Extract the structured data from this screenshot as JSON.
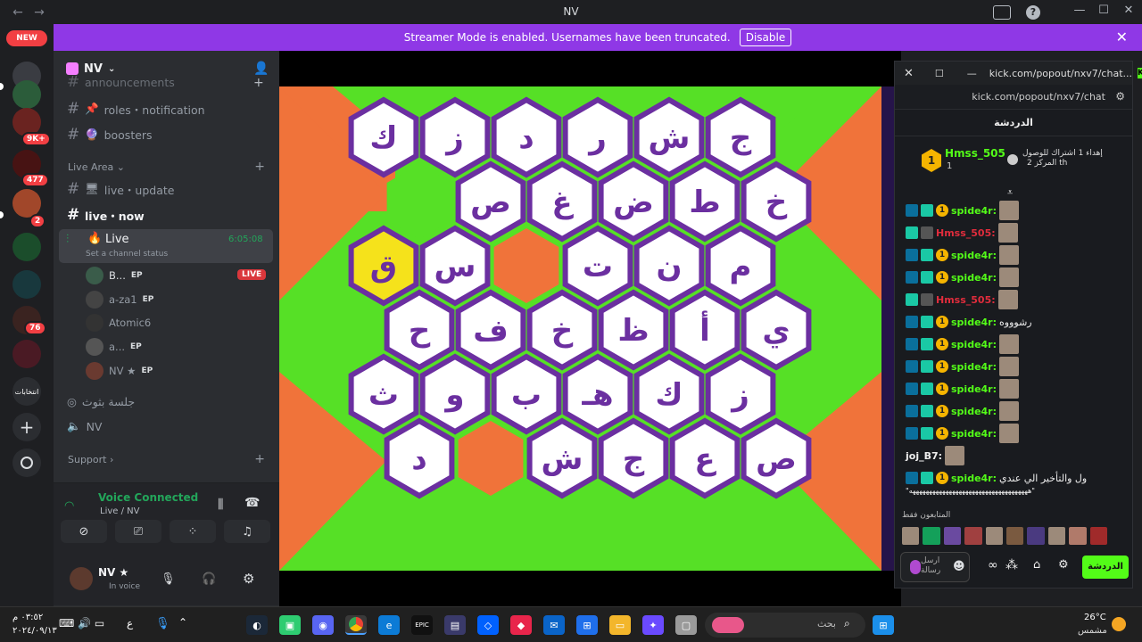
{
  "titlebar": {
    "title": "NV",
    "back": "←",
    "forward": "→",
    "minimize": "—",
    "maximize": "☐",
    "close": "✕"
  },
  "rail": {
    "new_label": "NEW",
    "badges": [
      "9K+",
      "477",
      "2",
      "76"
    ],
    "server_label": "انتخابات",
    "add": "+"
  },
  "banner": {
    "text": "Streamer Mode is enabled. Usernames have been truncated.",
    "button": "Disable",
    "close": "✕"
  },
  "server": {
    "name": "NV"
  },
  "channels": {
    "top_cut": "announcements",
    "roles": "roles・notification",
    "boosters": "boosters",
    "cat_live": "Live Area",
    "live_update": "live・update",
    "live_now": "live・now",
    "voice_live": "Live",
    "voice_live_time": "6:05:08",
    "voice_live_status": "Set a channel status",
    "voice_jalsa": "جلسة بثوث",
    "voice_nv": "NV",
    "cat_support": "Support"
  },
  "voice_users": [
    {
      "name": "B...",
      "ep": "EP",
      "live": "LIVE"
    },
    {
      "name": "a-za1",
      "ep": "EP"
    },
    {
      "name": "Atomic6",
      "ep": ""
    },
    {
      "name": "a...",
      "ep": "EP"
    },
    {
      "name": "NV ★",
      "ep": "EP"
    }
  ],
  "voice_panel": {
    "status": "Voice Connected",
    "channel": "Live / NV"
  },
  "user_panel": {
    "name": "NV ★",
    "status": "In voice"
  },
  "game": {
    "rows": [
      [
        "ك",
        "ز",
        "د",
        "ر",
        "ش",
        "ج"
      ],
      [
        "",
        "ص",
        "غ",
        "ض",
        "ط",
        "خ"
      ],
      [
        "ق",
        "س",
        "",
        "ت",
        "ن",
        "م"
      ],
      [
        "ح",
        "ف",
        "خ",
        "ظ",
        "أ",
        "ي"
      ],
      [
        "ث",
        "و",
        "ب",
        "هـ",
        "ك",
        "ز"
      ],
      [
        "د",
        "",
        "ش",
        "ج",
        "ع",
        "ص"
      ]
    ],
    "green": "#56e026",
    "orange": "#f0733a",
    "purple": "#6b2fa0",
    "yellow": "#f5e21b"
  },
  "kick": {
    "url_title": "kick.com/popout/nxv7/chat...",
    "url": "kick.com/popout/nxv7/chat",
    "chat_title": "الدردشة",
    "gifter_name": "Hmss_505",
    "gifter_count": "1",
    "gifter_rank": "1",
    "gift_line1": "إهداء 1 اشتراك للوصول",
    "gift_line2": "2 المركز th",
    "messages": [
      {
        "user": "spide4r",
        "text": ""
      },
      {
        "user": "Hmss_505",
        "text": ""
      },
      {
        "user": "spide4r",
        "text": ""
      },
      {
        "user": "spide4r",
        "text": ""
      },
      {
        "user": "Hmss_505",
        "text": ""
      },
      {
        "user": "spide4r",
        "text": "رشوووه"
      },
      {
        "user": "spide4r",
        "text": ""
      },
      {
        "user": "spide4r",
        "text": ""
      },
      {
        "user": "spide4r",
        "text": ""
      },
      {
        "user": "spide4r",
        "text": ""
      },
      {
        "user": "spide4r",
        "text": ""
      },
      {
        "user": "joj_B7",
        "text": ""
      },
      {
        "user": "spide4r",
        "text": "ول والتأخير الي عندي"
      }
    ],
    "spam_line": "\"ههههههههههههههههههههههههههههههههههههه\"",
    "viewers_label": "المتابعون فقط",
    "chat_button": "الدردشة",
    "send_label": "ارسل رسالة"
  },
  "taskbar": {
    "time": "٠٣:٥٢ م",
    "date": "٢٠٢٤/٠٩/١٣",
    "search": "بحث",
    "weather_temp": "26°C",
    "weather_text": "مشمس",
    "lang": "ع"
  }
}
